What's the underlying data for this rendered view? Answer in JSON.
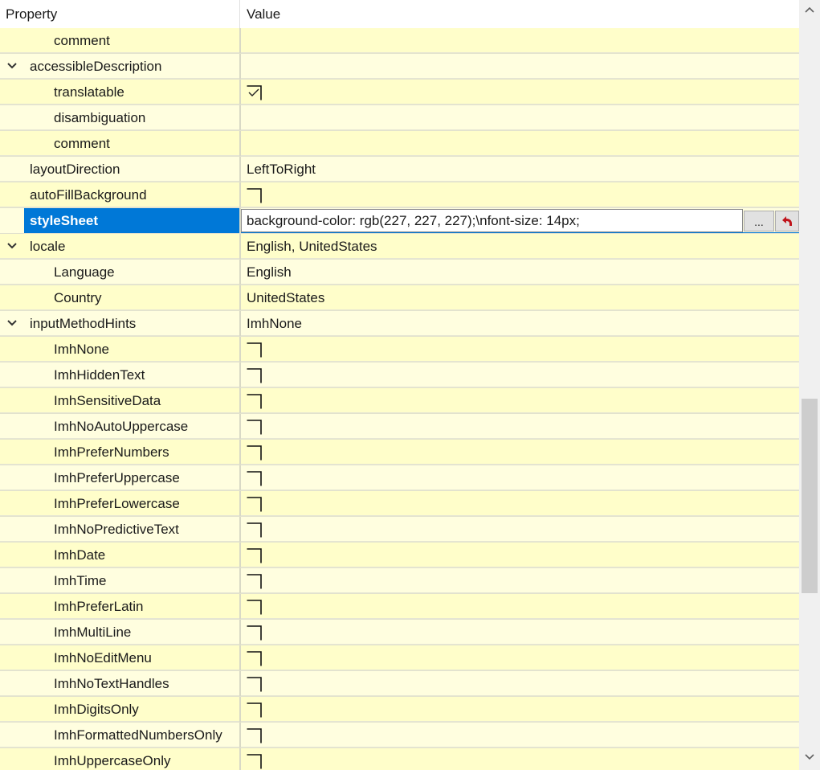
{
  "header": {
    "property_label": "Property",
    "value_label": "Value"
  },
  "rows": [
    {
      "name": "comment",
      "value": "",
      "level": 1,
      "bg": "yellow"
    },
    {
      "name": "accessibleDescription",
      "value": "",
      "level": 0,
      "bg": "light",
      "expandable": true
    },
    {
      "name": "translatable",
      "value": "",
      "level": 1,
      "bg": "yellow",
      "checkbox": true,
      "checked": true
    },
    {
      "name": "disambiguation",
      "value": "",
      "level": 1,
      "bg": "light"
    },
    {
      "name": "comment",
      "value": "",
      "level": 1,
      "bg": "yellow"
    },
    {
      "name": "layoutDirection",
      "value": "LeftToRight",
      "level": 0,
      "bg": "light"
    },
    {
      "name": "autoFillBackground",
      "value": "",
      "level": 0,
      "bg": "yellow",
      "checkbox": true,
      "checked": false
    },
    {
      "name": "styleSheet",
      "value": "background-color: rgb(227, 227, 227);\\nfont-size: 14px;",
      "level": 0,
      "bg": "light",
      "selected": true
    },
    {
      "name": "locale",
      "value": "English, UnitedStates",
      "level": 0,
      "bg": "yellow",
      "expandable": true
    },
    {
      "name": "Language",
      "value": "English",
      "level": 1,
      "bg": "light"
    },
    {
      "name": "Country",
      "value": "UnitedStates",
      "level": 1,
      "bg": "yellow"
    },
    {
      "name": "inputMethodHints",
      "value": "ImhNone",
      "level": 0,
      "bg": "light",
      "expandable": true
    },
    {
      "name": "ImhNone",
      "value": "",
      "level": 1,
      "bg": "yellow",
      "checkbox": true,
      "checked": false
    },
    {
      "name": "ImhHiddenText",
      "value": "",
      "level": 1,
      "bg": "light",
      "checkbox": true,
      "checked": false
    },
    {
      "name": "ImhSensitiveData",
      "value": "",
      "level": 1,
      "bg": "yellow",
      "checkbox": true,
      "checked": false
    },
    {
      "name": "ImhNoAutoUppercase",
      "value": "",
      "level": 1,
      "bg": "light",
      "checkbox": true,
      "checked": false
    },
    {
      "name": "ImhPreferNumbers",
      "value": "",
      "level": 1,
      "bg": "yellow",
      "checkbox": true,
      "checked": false
    },
    {
      "name": "ImhPreferUppercase",
      "value": "",
      "level": 1,
      "bg": "light",
      "checkbox": true,
      "checked": false
    },
    {
      "name": "ImhPreferLowercase",
      "value": "",
      "level": 1,
      "bg": "yellow",
      "checkbox": true,
      "checked": false
    },
    {
      "name": "ImhNoPredictiveText",
      "value": "",
      "level": 1,
      "bg": "light",
      "checkbox": true,
      "checked": false
    },
    {
      "name": "ImhDate",
      "value": "",
      "level": 1,
      "bg": "yellow",
      "checkbox": true,
      "checked": false
    },
    {
      "name": "ImhTime",
      "value": "",
      "level": 1,
      "bg": "light",
      "checkbox": true,
      "checked": false
    },
    {
      "name": "ImhPreferLatin",
      "value": "",
      "level": 1,
      "bg": "yellow",
      "checkbox": true,
      "checked": false
    },
    {
      "name": "ImhMultiLine",
      "value": "",
      "level": 1,
      "bg": "light",
      "checkbox": true,
      "checked": false
    },
    {
      "name": "ImhNoEditMenu",
      "value": "",
      "level": 1,
      "bg": "yellow",
      "checkbox": true,
      "checked": false
    },
    {
      "name": "ImhNoTextHandles",
      "value": "",
      "level": 1,
      "bg": "light",
      "checkbox": true,
      "checked": false
    },
    {
      "name": "ImhDigitsOnly",
      "value": "",
      "level": 1,
      "bg": "yellow",
      "checkbox": true,
      "checked": false
    },
    {
      "name": "ImhFormattedNumbersOnly",
      "value": "",
      "level": 1,
      "bg": "light",
      "checkbox": true,
      "checked": false
    },
    {
      "name": "ImhUppercaseOnly",
      "value": "",
      "level": 1,
      "bg": "yellow",
      "checkbox": true,
      "checked": false
    }
  ],
  "stylesheet_editor": {
    "browse_label": "...",
    "reset_icon": "reset-arrow-icon"
  },
  "colors": {
    "selection": "#0078d7",
    "row_yellow": "#fffeca",
    "row_light": "#fffedf",
    "reset_icon": "#c0141b"
  },
  "scrollbar": {
    "up_icon": "chevron-up-icon",
    "down_icon": "chevron-down-icon",
    "thumb_fraction_start": 0.52,
    "thumb_fraction_size": 0.25
  }
}
